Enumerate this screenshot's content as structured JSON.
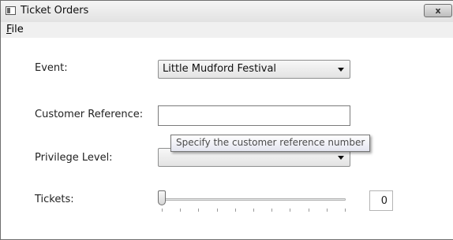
{
  "window": {
    "title": "Ticket Orders",
    "close_label": "x"
  },
  "menu": {
    "file_mnemonic": "F",
    "file_rest": "ile"
  },
  "form": {
    "event_label": "Event:",
    "event_value": "Little Mudford Festival",
    "customer_reference_label": "Customer Reference:",
    "customer_reference_value": "",
    "tooltip": "Specify the customer reference number",
    "privilege_label": "Privilege Level:",
    "privilege_value": "",
    "tickets_label": "Tickets:",
    "tickets_slider_fraction": 0,
    "tickets_value": "0"
  }
}
